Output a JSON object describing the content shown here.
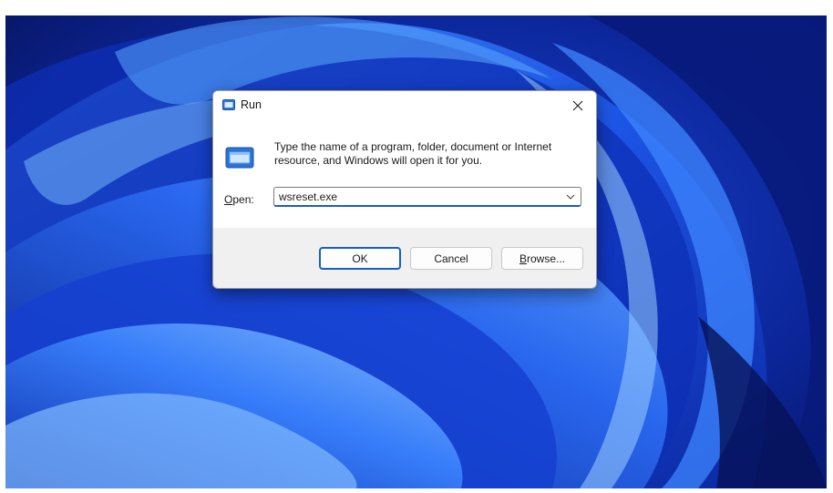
{
  "dialog": {
    "title": "Run",
    "description": "Type the name of a program, folder, document or Internet resource, and Windows will open it for you.",
    "open_label_mnemonic": "O",
    "open_label_rest": "pen:",
    "input_value": "wsreset.exe",
    "buttons": {
      "ok": "OK",
      "cancel": "Cancel",
      "browse_mnemonic": "B",
      "browse_rest": "rowse..."
    }
  },
  "icons": {
    "title": "run-app-icon",
    "close": "close-icon",
    "dropdown": "chevron-down-icon",
    "body": "run-app-icon"
  },
  "colors": {
    "wallpaper_dark": "#0a1a6e",
    "wallpaper_bright": "#2f7bff",
    "accent": "#1b5fbd"
  }
}
